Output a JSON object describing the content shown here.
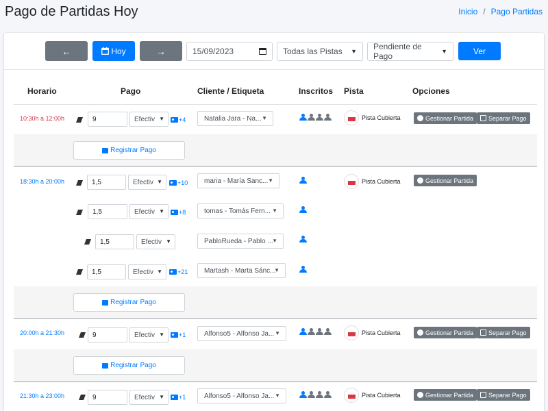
{
  "header": {
    "title": "Pago de Partidas Hoy",
    "breadcrumb": {
      "home": "Inicio",
      "separator": "/",
      "current": "Pago Partidas"
    }
  },
  "filters": {
    "prev_icon": "←",
    "today_label": "Hoy",
    "next_icon": "→",
    "date": "15/09/2023",
    "pista": "Todas las Pistas",
    "estado": "Pendiente de Pago",
    "submit_label": "Ver"
  },
  "columns": {
    "horario": "Horario",
    "pago": "Pago",
    "cliente": "Cliente / Etiqueta",
    "inscritos": "Inscritos",
    "pista": "Pista",
    "opciones": "Opciones"
  },
  "labels": {
    "registrar": "Registrar Pago",
    "gestionar": "Gestionar Partida",
    "separar": "Separar Pago",
    "metodo": "Efectiv",
    "pista": "Pista Cubierta"
  },
  "matches": [
    {
      "time": "10:30h a 12:00h",
      "players": [
        {
          "amount": "9",
          "tag": "+4",
          "client": "Natalia Jara - Na..."
        }
      ]
    },
    {
      "time": "18:30h a 20:00h",
      "players": [
        {
          "amount": "1,5",
          "tag": "+10",
          "client": "maria - María Sanc..."
        },
        {
          "amount": "1,5",
          "tag": "+8",
          "client": "tomas - Tomás Fern..."
        },
        {
          "amount": "1,5",
          "tag": "",
          "client": "PabloRueda - Pablo ..."
        },
        {
          "amount": "1,5",
          "tag": "+21",
          "client": "Martash - Marta Sánc..."
        }
      ]
    },
    {
      "time": "20:00h a 21:30h",
      "players": [
        {
          "amount": "9",
          "tag": "+1",
          "client": "Alfonso5 - Alfonso Ja..."
        }
      ]
    },
    {
      "time": "21:30h a 23:00h",
      "players": [
        {
          "amount": "9",
          "tag": "+1",
          "client": "Alfonso5 - Alfonso Ja..."
        }
      ]
    }
  ],
  "colors": {
    "primary": "#007bff",
    "secondary": "#6c757d",
    "danger": "#dc3545"
  },
  "icons": [
    "arrow-left-icon",
    "calendar-icon",
    "arrow-right-icon",
    "eraser-icon",
    "id-card-icon",
    "user-icon",
    "cash-register-icon",
    "circle-icon",
    "copy-icon"
  ]
}
